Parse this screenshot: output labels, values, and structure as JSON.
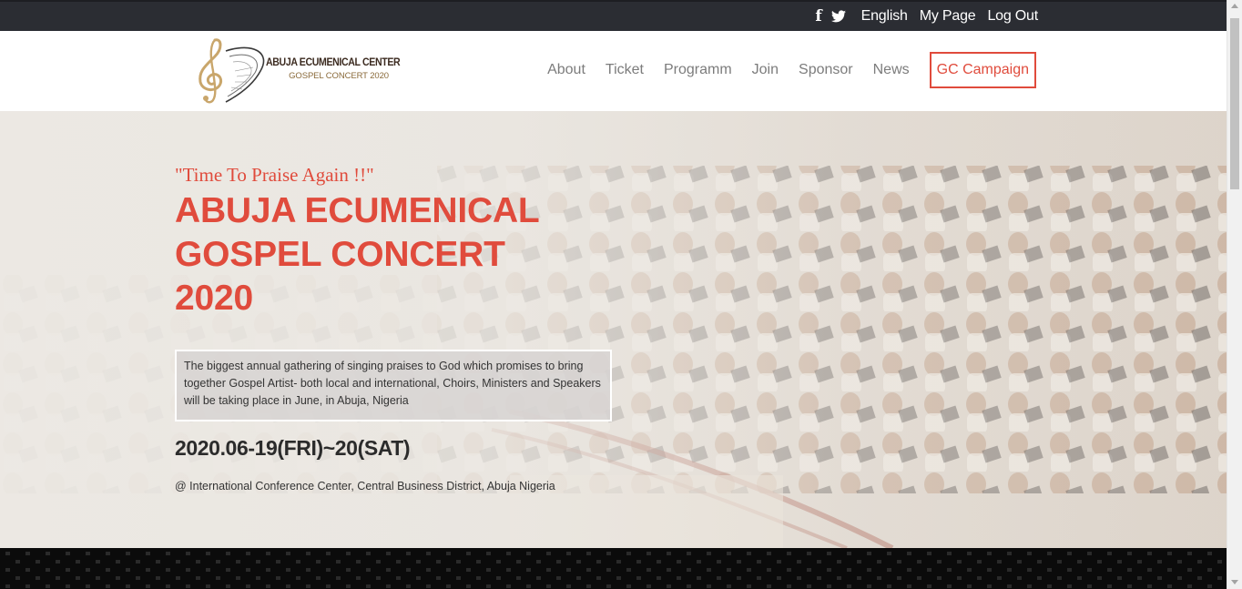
{
  "topbar": {
    "social": [
      "facebook-icon",
      "twitter-icon"
    ],
    "language": "English",
    "my_page": "My Page",
    "logout": "Log Out"
  },
  "logo": {
    "line1": "ABUJA ECUMENICAL CENTER",
    "line2": "GOSPEL CONCERT 2020"
  },
  "nav": {
    "items": [
      "About",
      "Ticket",
      "Programm",
      "Join",
      "Sponsor",
      "News"
    ],
    "campaign": "GC Campaign"
  },
  "hero": {
    "tagline": "\"Time To Praise Again !!\"",
    "title_line1": "ABUJA ECUMENICAL",
    "title_line2": "GOSPEL CONCERT",
    "title_line3": "2020",
    "description": "The biggest annual gathering of singing praises to God which promises to bring together Gospel Artist- both local and international, Choirs, Ministers and Speakers will be taking place in June, in Abuja, Nigeria",
    "date": "2020.06-19(FRI)~20(SAT)",
    "venue": "@ International Conference Center, Central Business District, Abuja Nigeria"
  },
  "colors": {
    "accent": "#e04b3c",
    "topbar_bg": "#2b2d33",
    "nav_text": "#7c7c7c"
  }
}
